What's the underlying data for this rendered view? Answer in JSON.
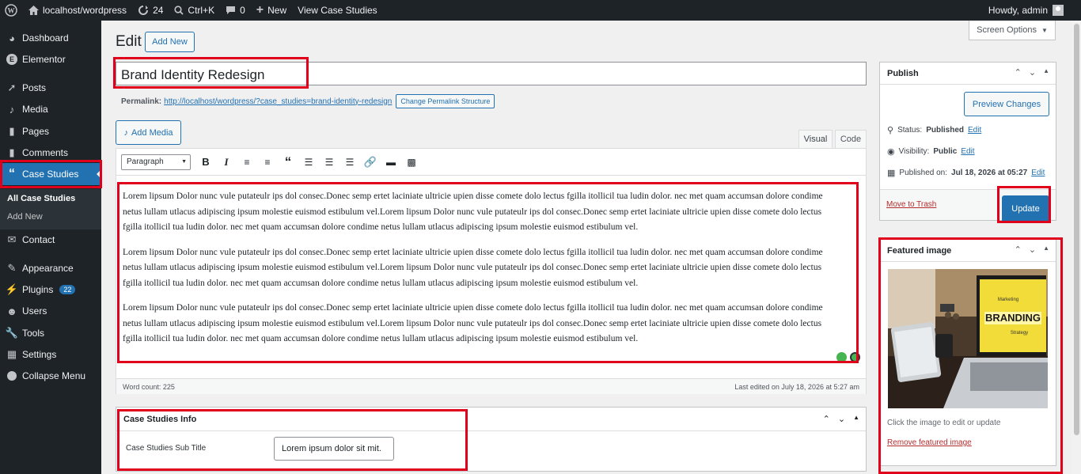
{
  "admin_bar": {
    "site": "localhost/wordpress",
    "updates": "24",
    "shortcut": "Ctrl+K",
    "comments": "0",
    "new_label": "New",
    "view_label": "View Case Studies",
    "howdy": "Howdy, admin"
  },
  "sidebar": {
    "items": [
      {
        "label": "Dashboard",
        "icon": "dashboard-icon"
      },
      {
        "label": "Elementor",
        "icon": "elementor-icon"
      },
      {
        "label": "Posts",
        "icon": "pin-icon"
      },
      {
        "label": "Media",
        "icon": "media-icon"
      },
      {
        "label": "Pages",
        "icon": "page-icon"
      },
      {
        "label": "Comments",
        "icon": "comment-icon"
      },
      {
        "label": "Case Studies",
        "icon": "quote-icon"
      },
      {
        "label": "Contact",
        "icon": "mail-icon"
      },
      {
        "label": "Appearance",
        "icon": "brush-icon"
      },
      {
        "label": "Plugins",
        "icon": "plugin-icon",
        "badge": "22"
      },
      {
        "label": "Users",
        "icon": "user-icon"
      },
      {
        "label": "Tools",
        "icon": "wrench-icon"
      },
      {
        "label": "Settings",
        "icon": "settings-icon"
      },
      {
        "label": "Collapse Menu",
        "icon": "collapse-icon"
      }
    ],
    "submenu": [
      "All Case Studies",
      "Add New"
    ]
  },
  "header": {
    "title": "Edit",
    "add_new": "Add New",
    "screen_options": "Screen Options"
  },
  "post": {
    "title": "Brand Identity Redesign",
    "permalink_label": "Permalink:",
    "permalink_url": "http://localhost/wordpress/?case_studies=brand-identity-redesign",
    "permalink_button": "Change Permalink Structure"
  },
  "editor": {
    "add_media": "Add Media",
    "tab_visual": "Visual",
    "tab_code": "Code",
    "format": "Paragraph",
    "paragraphs": [
      "Lorem lipsum Dolor nunc vule putateulr ips dol consec.Donec semp ertet laciniate ultricie upien disse comete dolo lectus fgilla itollicil tua ludin dolor. nec met quam accumsan dolore condime netus lullam utlacus adipiscing ipsum molestie euismod estibulum vel.Lorem lipsum Dolor nunc vule putateulr ips dol consec.Donec semp ertet laciniate ultricie upien disse comete dolo lectus fgilla itollicil tua ludin dolor. nec met quam accumsan dolore condime netus lullam utlacus adipiscing ipsum molestie euismod estibulum vel.",
      "Lorem lipsum Dolor nunc vule putateulr ips dol consec.Donec semp ertet laciniate ultricie upien disse comete dolo lectus fgilla itollicil tua ludin dolor. nec met quam accumsan dolore condime netus lullam utlacus adipiscing ipsum molestie euismod estibulum vel.Lorem lipsum Dolor nunc vule putateulr ips dol consec.Donec semp ertet laciniate ultricie upien disse comete dolo lectus fgilla itollicil tua ludin dolor. nec met quam accumsan dolore condime netus lullam utlacus adipiscing ipsum molestie euismod estibulum vel.",
      "Lorem lipsum Dolor nunc vule putateulr ips dol consec.Donec semp ertet laciniate ultricie upien disse comete dolo lectus fgilla itollicil tua ludin dolor. nec met quam accumsan dolore condime netus lullam utlacus adipiscing ipsum molestie euismod estibulum vel.Lorem lipsum Dolor nunc vule putateulr ips dol consec.Donec semp ertet laciniate ultricie upien disse comete dolo lectus fgilla itollicil tua ludin dolor. nec met quam accumsan dolore condime netus lullam utlacus adipiscing ipsum molestie euismod estibulum vel."
    ],
    "word_count": "Word count: 225",
    "last_edited": "Last edited on July 18, 2026 at 5:27 am"
  },
  "metabox": {
    "title": "Case Studies Info",
    "field_label": "Case Studies Sub Title",
    "field_value": "Lorem ipsum dolor sit mit."
  },
  "publish": {
    "title": "Publish",
    "preview": "Preview Changes",
    "status_label": "Status:",
    "status_value": "Published",
    "visibility_label": "Visibility:",
    "visibility_value": "Public",
    "published_label": "Published on:",
    "published_value": "Jul 18, 2026 at 05:27",
    "edit": "Edit",
    "trash": "Move to Trash",
    "update": "Update"
  },
  "featured": {
    "title": "Featured image",
    "image_text": "BRANDING",
    "image_tag1": "Marketing",
    "image_tag2": "Strategy",
    "note": "Click the image to edit or update",
    "remove": "Remove featured image"
  },
  "colors": {
    "accent": "#2271b1",
    "active_menu": "#2271b1",
    "admin_bg": "#1d2327",
    "highlight": "#e0001b"
  }
}
